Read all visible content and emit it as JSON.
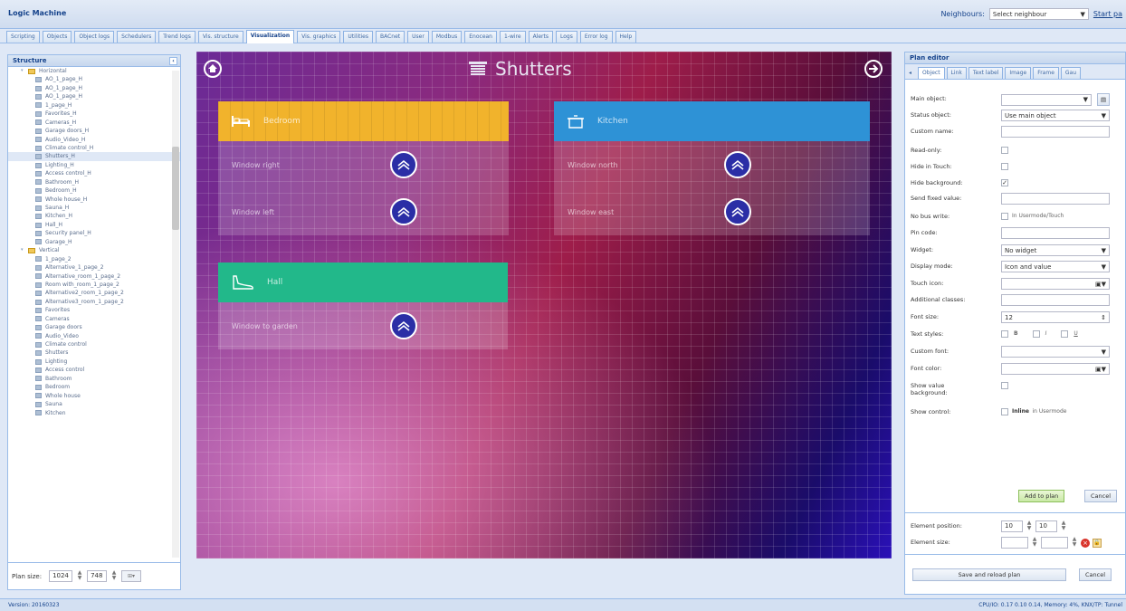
{
  "app": {
    "title": "Logic Machine"
  },
  "header": {
    "neighbours_label": "Neighbours:",
    "neighbours_select": "Select neighbour",
    "start_link": "Start pa"
  },
  "tabs": [
    {
      "label": "Scripting"
    },
    {
      "label": "Objects"
    },
    {
      "label": "Object logs"
    },
    {
      "label": "Schedulers"
    },
    {
      "label": "Trend logs"
    },
    {
      "label": "Vis. structure"
    },
    {
      "label": "Visualization"
    },
    {
      "label": "Vis. graphics"
    },
    {
      "label": "Utilities"
    },
    {
      "label": "BACnet"
    },
    {
      "label": "User"
    },
    {
      "label": "Modbus"
    },
    {
      "label": "Enocean"
    },
    {
      "label": "1-wire"
    },
    {
      "label": "Alerts"
    },
    {
      "label": "Logs"
    },
    {
      "label": "Error log"
    },
    {
      "label": "Help"
    }
  ],
  "structure": {
    "title": "Structure",
    "items": [
      {
        "label": "Horizontal",
        "type": "folder"
      },
      {
        "label": "AO_1_page_H"
      },
      {
        "label": "AO_1_page_H"
      },
      {
        "label": "AO_1_page_H"
      },
      {
        "label": "1_page_H"
      },
      {
        "label": "Favorites_H"
      },
      {
        "label": "Cameras_H"
      },
      {
        "label": "Garage doors_H"
      },
      {
        "label": "Audio_Video_H"
      },
      {
        "label": "Climate control_H"
      },
      {
        "label": "Shutters_H",
        "selected": true
      },
      {
        "label": "Lighting_H"
      },
      {
        "label": "Access control_H"
      },
      {
        "label": "Bathroom_H"
      },
      {
        "label": "Bedroom_H"
      },
      {
        "label": "Whole house_H"
      },
      {
        "label": "Sauna_H"
      },
      {
        "label": "Kitchen_H"
      },
      {
        "label": "Hall_H"
      },
      {
        "label": "Security panel_H"
      },
      {
        "label": "Garage_H"
      },
      {
        "label": "Vertical",
        "type": "folder"
      },
      {
        "label": "1_page_2"
      },
      {
        "label": "Alternative_1_page_2"
      },
      {
        "label": "Alternative_room_1_page_2"
      },
      {
        "label": "Room with_room_1_page_2"
      },
      {
        "label": "Alternative2_room_1_page_2"
      },
      {
        "label": "Alternative3_room_1_page_2"
      },
      {
        "label": "Favorites"
      },
      {
        "label": "Cameras"
      },
      {
        "label": "Garage doors"
      },
      {
        "label": "Audio_Video"
      },
      {
        "label": "Climate control"
      },
      {
        "label": "Shutters"
      },
      {
        "label": "Lighting"
      },
      {
        "label": "Access control"
      },
      {
        "label": "Bathroom"
      },
      {
        "label": "Bedroom"
      },
      {
        "label": "Whole house"
      },
      {
        "label": "Sauna"
      },
      {
        "label": "Kitchen"
      }
    ],
    "plan_size_label": "Plan size:",
    "plan_width": "1024",
    "plan_height": "748"
  },
  "canvas": {
    "title": "Shutters",
    "rooms": {
      "bedroom": {
        "name": "Bedroom",
        "rows": [
          "Window right",
          "Window left"
        ]
      },
      "kitchen": {
        "name": "Kitchen",
        "rows": [
          "Window north",
          "Window east"
        ]
      },
      "hall": {
        "name": "Hall",
        "rows": [
          "Window to garden"
        ]
      }
    },
    "colors": {
      "bedroom": "#f1b32c",
      "kitchen": "#2e92d6",
      "hall": "#22b88a",
      "button": "#2b2ea6"
    }
  },
  "plan_editor": {
    "title": "Plan editor",
    "tabs": [
      "Object",
      "Link",
      "Text label",
      "Image",
      "Frame",
      "Gau"
    ],
    "fields": {
      "main_object": "Main object:",
      "status_object": "Status object:",
      "status_object_value": "Use main object",
      "custom_name": "Custom name:",
      "read_only": "Read-only:",
      "hide_in_touch": "Hide in Touch:",
      "hide_background": "Hide background:",
      "send_fixed_value": "Send fixed value:",
      "no_bus_write": "No bus write:",
      "no_bus_write_note": "In Usermode/Touch",
      "pin_code": "Pin code:",
      "widget": "Widget:",
      "widget_value": "No widget",
      "display_mode": "Display mode:",
      "display_mode_value": "Icon and value",
      "touch_icon": "Touch icon:",
      "additional_classes": "Additional classes:",
      "font_size": "Font size:",
      "font_size_value": "12",
      "text_styles": "Text styles:",
      "style_b": "B",
      "style_i": "I",
      "style_u": "U",
      "custom_font": "Custom font:",
      "font_color": "Font color:",
      "show_value_bg": "Show value background:",
      "show_control": "Show control:",
      "show_control_note_bold": "Inline",
      "show_control_note": "in Usermode"
    },
    "add_to_plan": "Add to plan",
    "cancel": "Cancel",
    "element_position": "Element position:",
    "pos_x": "10",
    "pos_y": "10",
    "element_size": "Element size:",
    "save_reload": "Save and reload plan",
    "cancel2": "Cancel"
  },
  "status": {
    "version": "Version: 20160323",
    "cpu": "CPU/IO: 0.17 0.10 0.14, Memory: 4%, KNX/TP: Tunnel"
  }
}
